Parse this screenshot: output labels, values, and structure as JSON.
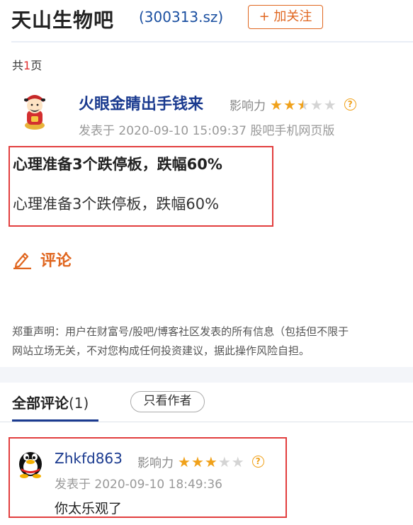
{
  "header": {
    "bar_name": "天山生物吧",
    "stock_code": "(300313.sz)",
    "follow_label": "+ 加关注"
  },
  "pagination": {
    "prefix": "共",
    "count": "1",
    "suffix": "页"
  },
  "post": {
    "author": "火眼金睛出手钱来",
    "influence_label": "影响力",
    "influence_stars": 2.5,
    "influence_max": 5,
    "meta": "发表于 2020-09-10 15:09:37 股吧手机网页版",
    "title": "心理准备3个跌停板，跌幅60%",
    "body": "心理准备3个跌停板，跌幅60%"
  },
  "comment_action": {
    "label": "评论"
  },
  "disclaimer": {
    "line1": "郑重声明：用户在财富号/股吧/博客社区发表的所有信息（包括但不限于",
    "line2": "网站立场无关，不对您构成任何投资建议，据此操作风险自担。"
  },
  "comments_section": {
    "tab_label": "全部评论",
    "tab_count": "(1)",
    "author_only_label": "只看作者",
    "items": [
      {
        "author": "Zhkfd863",
        "influence_label": "影响力",
        "influence_stars": 3,
        "influence_max": 5,
        "meta": "发表于 2020-09-10 18:49:36",
        "text": "你太乐观了"
      }
    ]
  },
  "colors": {
    "brand_orange": "#e0661f",
    "link_blue": "#1a3a8f",
    "highlight_red": "#e23e3e",
    "star_gold": "#f0a11a"
  }
}
